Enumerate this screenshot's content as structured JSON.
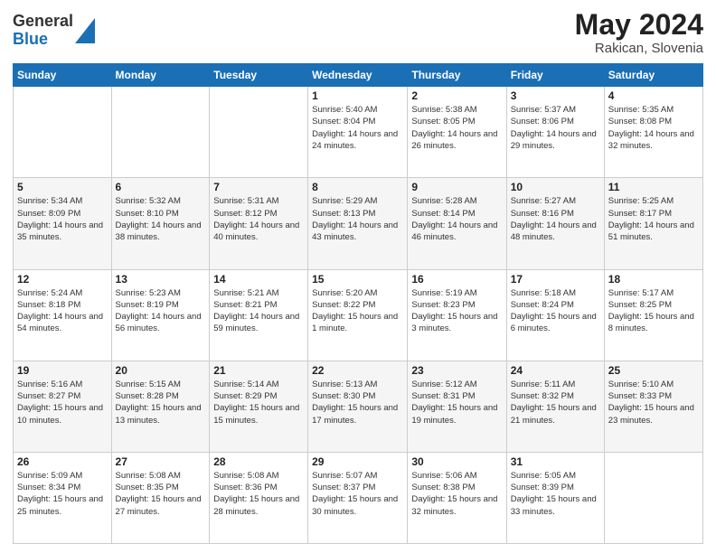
{
  "header": {
    "logo_general": "General",
    "logo_blue": "Blue",
    "month_year": "May 2024",
    "location": "Rakican, Slovenia"
  },
  "weekdays": [
    "Sunday",
    "Monday",
    "Tuesday",
    "Wednesday",
    "Thursday",
    "Friday",
    "Saturday"
  ],
  "weeks": [
    [
      {
        "day": "",
        "info": ""
      },
      {
        "day": "",
        "info": ""
      },
      {
        "day": "",
        "info": ""
      },
      {
        "day": "1",
        "info": "Sunrise: 5:40 AM\nSunset: 8:04 PM\nDaylight: 14 hours and 24 minutes."
      },
      {
        "day": "2",
        "info": "Sunrise: 5:38 AM\nSunset: 8:05 PM\nDaylight: 14 hours and 26 minutes."
      },
      {
        "day": "3",
        "info": "Sunrise: 5:37 AM\nSunset: 8:06 PM\nDaylight: 14 hours and 29 minutes."
      },
      {
        "day": "4",
        "info": "Sunrise: 5:35 AM\nSunset: 8:08 PM\nDaylight: 14 hours and 32 minutes."
      }
    ],
    [
      {
        "day": "5",
        "info": "Sunrise: 5:34 AM\nSunset: 8:09 PM\nDaylight: 14 hours and 35 minutes."
      },
      {
        "day": "6",
        "info": "Sunrise: 5:32 AM\nSunset: 8:10 PM\nDaylight: 14 hours and 38 minutes."
      },
      {
        "day": "7",
        "info": "Sunrise: 5:31 AM\nSunset: 8:12 PM\nDaylight: 14 hours and 40 minutes."
      },
      {
        "day": "8",
        "info": "Sunrise: 5:29 AM\nSunset: 8:13 PM\nDaylight: 14 hours and 43 minutes."
      },
      {
        "day": "9",
        "info": "Sunrise: 5:28 AM\nSunset: 8:14 PM\nDaylight: 14 hours and 46 minutes."
      },
      {
        "day": "10",
        "info": "Sunrise: 5:27 AM\nSunset: 8:16 PM\nDaylight: 14 hours and 48 minutes."
      },
      {
        "day": "11",
        "info": "Sunrise: 5:25 AM\nSunset: 8:17 PM\nDaylight: 14 hours and 51 minutes."
      }
    ],
    [
      {
        "day": "12",
        "info": "Sunrise: 5:24 AM\nSunset: 8:18 PM\nDaylight: 14 hours and 54 minutes."
      },
      {
        "day": "13",
        "info": "Sunrise: 5:23 AM\nSunset: 8:19 PM\nDaylight: 14 hours and 56 minutes."
      },
      {
        "day": "14",
        "info": "Sunrise: 5:21 AM\nSunset: 8:21 PM\nDaylight: 14 hours and 59 minutes."
      },
      {
        "day": "15",
        "info": "Sunrise: 5:20 AM\nSunset: 8:22 PM\nDaylight: 15 hours and 1 minute."
      },
      {
        "day": "16",
        "info": "Sunrise: 5:19 AM\nSunset: 8:23 PM\nDaylight: 15 hours and 3 minutes."
      },
      {
        "day": "17",
        "info": "Sunrise: 5:18 AM\nSunset: 8:24 PM\nDaylight: 15 hours and 6 minutes."
      },
      {
        "day": "18",
        "info": "Sunrise: 5:17 AM\nSunset: 8:25 PM\nDaylight: 15 hours and 8 minutes."
      }
    ],
    [
      {
        "day": "19",
        "info": "Sunrise: 5:16 AM\nSunset: 8:27 PM\nDaylight: 15 hours and 10 minutes."
      },
      {
        "day": "20",
        "info": "Sunrise: 5:15 AM\nSunset: 8:28 PM\nDaylight: 15 hours and 13 minutes."
      },
      {
        "day": "21",
        "info": "Sunrise: 5:14 AM\nSunset: 8:29 PM\nDaylight: 15 hours and 15 minutes."
      },
      {
        "day": "22",
        "info": "Sunrise: 5:13 AM\nSunset: 8:30 PM\nDaylight: 15 hours and 17 minutes."
      },
      {
        "day": "23",
        "info": "Sunrise: 5:12 AM\nSunset: 8:31 PM\nDaylight: 15 hours and 19 minutes."
      },
      {
        "day": "24",
        "info": "Sunrise: 5:11 AM\nSunset: 8:32 PM\nDaylight: 15 hours and 21 minutes."
      },
      {
        "day": "25",
        "info": "Sunrise: 5:10 AM\nSunset: 8:33 PM\nDaylight: 15 hours and 23 minutes."
      }
    ],
    [
      {
        "day": "26",
        "info": "Sunrise: 5:09 AM\nSunset: 8:34 PM\nDaylight: 15 hours and 25 minutes."
      },
      {
        "day": "27",
        "info": "Sunrise: 5:08 AM\nSunset: 8:35 PM\nDaylight: 15 hours and 27 minutes."
      },
      {
        "day": "28",
        "info": "Sunrise: 5:08 AM\nSunset: 8:36 PM\nDaylight: 15 hours and 28 minutes."
      },
      {
        "day": "29",
        "info": "Sunrise: 5:07 AM\nSunset: 8:37 PM\nDaylight: 15 hours and 30 minutes."
      },
      {
        "day": "30",
        "info": "Sunrise: 5:06 AM\nSunset: 8:38 PM\nDaylight: 15 hours and 32 minutes."
      },
      {
        "day": "31",
        "info": "Sunrise: 5:05 AM\nSunset: 8:39 PM\nDaylight: 15 hours and 33 minutes."
      },
      {
        "day": "",
        "info": ""
      }
    ]
  ]
}
